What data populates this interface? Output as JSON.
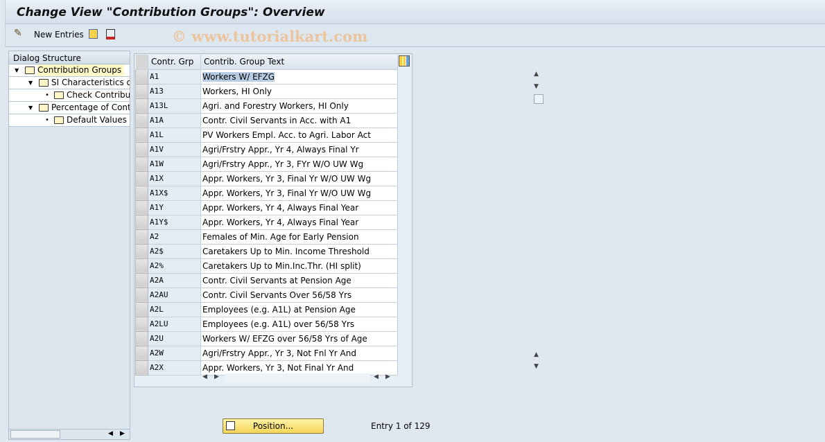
{
  "title": "Change View \"Contribution Groups\": Overview",
  "toolbar": {
    "new_entries": "New Entries",
    "watermark": "© www.tutorialkart.com"
  },
  "dialog": {
    "header": "Dialog Structure",
    "nodes": [
      {
        "label": "Contribution Groups",
        "level": 0,
        "expanded": true,
        "selected": true
      },
      {
        "label": "SI Characteristics of Contribution Groups",
        "level": 1,
        "expanded": true
      },
      {
        "label": "Check Contribution Groups",
        "level": 2
      },
      {
        "label": "Percentage of Contribution",
        "level": 1,
        "expanded": true
      },
      {
        "label": "Default Values for",
        "level": 2
      }
    ]
  },
  "table": {
    "columns": [
      "Contr. Grp",
      "Contrib. Group Text"
    ],
    "rows": [
      [
        "A1",
        "Workers W/ EFZG"
      ],
      [
        "A13",
        "Workers, HI Only"
      ],
      [
        "A13L",
        "Agri. and Forestry Workers, HI Only"
      ],
      [
        "A1A",
        "Contr. Civil Servants in Acc. with A1"
      ],
      [
        "A1L",
        "PV Workers Empl. Acc. to Agri. Labor Act"
      ],
      [
        "A1V",
        "Agri/Frstry Appr., Yr 4, Always Final Yr"
      ],
      [
        "A1W",
        "Agri/Frstry Appr., Yr 3, FYr W/O UW Wg"
      ],
      [
        "A1X",
        "Appr. Workers, Yr 3, Final Yr W/O UW Wg"
      ],
      [
        "A1X$",
        "Appr. Workers, Yr 3, Final Yr W/O UW Wg"
      ],
      [
        "A1Y",
        "Appr. Workers, Yr 4, Always Final Year"
      ],
      [
        "A1Y$",
        "Appr. Workers, Yr 4, Always Final Year"
      ],
      [
        "A2",
        "Females of Min. Age for Early Pension"
      ],
      [
        "A2$",
        "Caretakers Up to Min. Income Threshold"
      ],
      [
        "A2%",
        "Caretakers Up to Min.Inc.Thr. (HI split)"
      ],
      [
        "A2A",
        "Contr. Civil Servants at Pension Age"
      ],
      [
        "A2AU",
        "Contr. Civil Servants Over 56/58 Yrs"
      ],
      [
        "A2L",
        "Employees (e.g. A1L) at Pension Age"
      ],
      [
        "A2LU",
        "Employees (e.g. A1L) over 56/58 Yrs"
      ],
      [
        "A2U",
        "Workers W/ EFZG over 56/58 Yrs of Age"
      ],
      [
        "A2W",
        "Agri/Frstry Appr., Yr 3, Not Fnl Yr And"
      ],
      [
        "A2X",
        "Appr. Workers, Yr 3, Not Final Yr And"
      ]
    ]
  },
  "position_button": "Position...",
  "entry_text": "Entry 1 of 129"
}
